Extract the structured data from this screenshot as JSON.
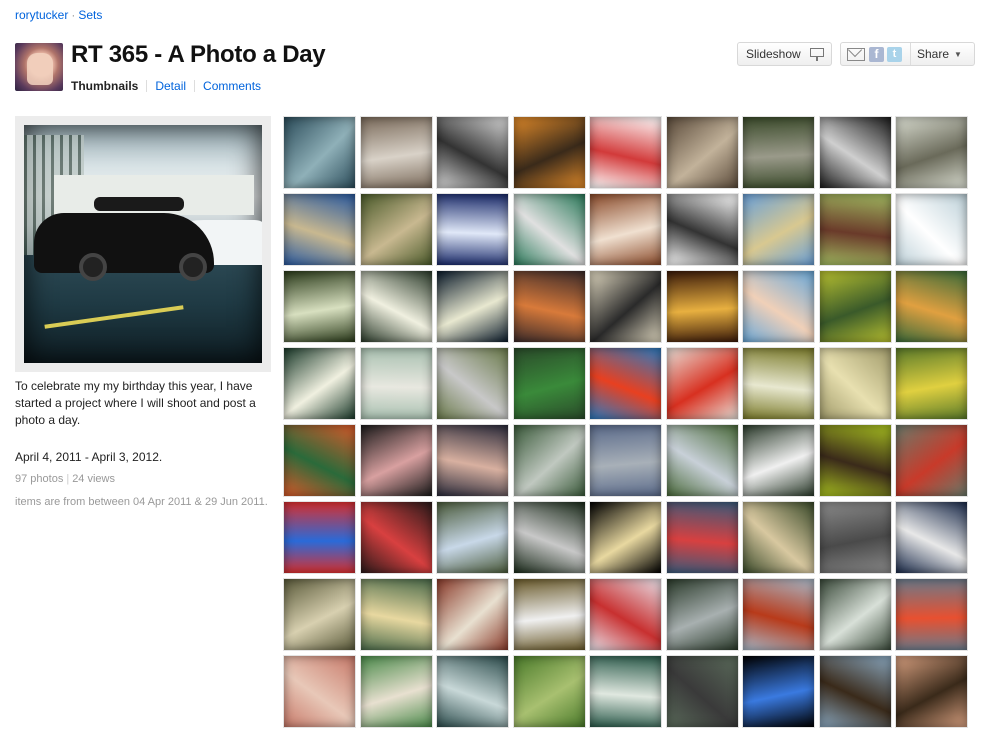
{
  "breadcrumb": {
    "user": "rorytucker",
    "separator": "·",
    "section": "Sets"
  },
  "set": {
    "title": "RT 365 - A Photo a Day"
  },
  "tabs": {
    "thumbnails": "Thumbnails",
    "detail": "Detail",
    "comments": "Comments"
  },
  "toolbar": {
    "slideshow_label": "Slideshow",
    "share_label": "Share",
    "facebook": "f",
    "twitter": "t"
  },
  "description": {
    "text": "To celebrate my my birthday this year, I have started a project where I will shoot and post a photo a day.",
    "dates": "April 4, 2011 - April 3, 2012.",
    "photos": "97 photos",
    "views": "24 views",
    "range": "items are from between 04 Apr 2011 & 29 Jun 2011."
  },
  "colors": {
    "link": "#0063dc",
    "muted": "#999999"
  },
  "thumbnails": [
    {
      "c1": "#2b4c5a",
      "c2": "#8fb0b8"
    },
    {
      "c1": "#7a6a5a",
      "c2": "#d9d2c8"
    },
    {
      "c1": "#d8d8d8",
      "c2": "#333333"
    },
    {
      "c1": "#e08a2a",
      "c2": "#3a2a1a"
    },
    {
      "c1": "#ffffff",
      "c2": "#d23a3a"
    },
    {
      "c1": "#5a4a3a",
      "c2": "#c2b29a"
    },
    {
      "c1": "#3a4a2a",
      "c2": "#9a9a8a"
    },
    {
      "c1": "#1a1a1a",
      "c2": "#cfcfcf"
    },
    {
      "c1": "#d9dcd0",
      "c2": "#6a6a5a"
    },
    {
      "c1": "#2a5aa0",
      "c2": "#c8b890"
    },
    {
      "c1": "#4a5a2a",
      "c2": "#c8b890"
    },
    {
      "c1": "#1a2a6a",
      "c2": "#e0e8f8"
    },
    {
      "c1": "#2a7a5a",
      "c2": "#e0e0e0"
    },
    {
      "c1": "#8a4a2a",
      "c2": "#f0e0d0"
    },
    {
      "c1": "#ffffff",
      "c2": "#333333"
    },
    {
      "c1": "#6aa0d8",
      "c2": "#d8c890"
    },
    {
      "c1": "#a0b860",
      "c2": "#6a3a2a"
    },
    {
      "c1": "#bcd0d8",
      "c2": "#ffffff"
    },
    {
      "c1": "#2a3a1a",
      "c2": "#d8e0c0"
    },
    {
      "c1": "#2a3a2a",
      "c2": "#f0f0e0"
    },
    {
      "c1": "#0a1a2a",
      "c2": "#e8e8d0"
    },
    {
      "c1": "#3a2a2a",
      "c2": "#d87a3a"
    },
    {
      "c1": "#e0d8c0",
      "c2": "#2a2a2a"
    },
    {
      "c1": "#3a1a0a",
      "c2": "#e8b040"
    },
    {
      "c1": "#6aa8d8",
      "c2": "#f0d0b8"
    },
    {
      "c1": "#b8c030",
      "c2": "#3a5a2a"
    },
    {
      "c1": "#3a6a3a",
      "c2": "#e0a040"
    },
    {
      "c1": "#1a3a2a",
      "c2": "#f0f0e0"
    },
    {
      "c1": "#a8c0b0",
      "c2": "#e8e8e0"
    },
    {
      "c1": "#6a7a4a",
      "c2": "#c8c8c8"
    },
    {
      "c1": "#2a4a2a",
      "c2": "#3a8a3a"
    },
    {
      "c1": "#2a7ac0",
      "c2": "#e84020"
    },
    {
      "c1": "#e8e0d8",
      "c2": "#d83020"
    },
    {
      "c1": "#7a7a2a",
      "c2": "#e8e8d0"
    },
    {
      "c1": "#a09a6a",
      "c2": "#e8e0b0"
    },
    {
      "c1": "#5a7a2a",
      "c2": "#e0d040"
    },
    {
      "c1": "#d85a2a",
      "c2": "#2a6a3a"
    },
    {
      "c1": "#1a1a1a",
      "c2": "#d8a0a0"
    },
    {
      "c1": "#2a2a3a",
      "c2": "#d8b0a0"
    },
    {
      "c1": "#3a5a3a",
      "c2": "#c0c8c0"
    },
    {
      "c1": "#5a6a8a",
      "c2": "#a8b0b8"
    },
    {
      "c1": "#4a6a3a",
      "c2": "#c8d0d8"
    },
    {
      "c1": "#2a3a2a",
      "c2": "#f0f0f0"
    },
    {
      "c1": "#a8c020",
      "c2": "#3a2a1a"
    },
    {
      "c1": "#6a7a6a",
      "c2": "#c83a2a"
    },
    {
      "c1": "#d83030",
      "c2": "#2a6ad8"
    },
    {
      "c1": "#2a1a1a",
      "c2": "#d84040"
    },
    {
      "c1": "#4a5a3a",
      "c2": "#c8d8e8"
    },
    {
      "c1": "#1a2a1a",
      "c2": "#c8c8c8"
    },
    {
      "c1": "#000000",
      "c2": "#e8d8a0"
    },
    {
      "c1": "#3a5a7a",
      "c2": "#d84040"
    },
    {
      "c1": "#3a4a2a",
      "c2": "#d8c8a0"
    },
    {
      "c1": "#8a8a8a",
      "c2": "#4a4a4a"
    },
    {
      "c1": "#1a2a4a",
      "c2": "#e8e8e8"
    },
    {
      "c1": "#5a5a3a",
      "c2": "#d8d0b0"
    },
    {
      "c1": "#4a6a4a",
      "c2": "#e8d8a0"
    },
    {
      "c1": "#8a3a2a",
      "c2": "#e8e0d0"
    },
    {
      "c1": "#6a5a2a",
      "c2": "#f0f0f0"
    },
    {
      "c1": "#e8e0e8",
      "c2": "#c83030"
    },
    {
      "c1": "#2a3a2a",
      "c2": "#a8b0b0"
    },
    {
      "c1": "#a8b8c8",
      "c2": "#b83a1a"
    },
    {
      "c1": "#3a4a3a",
      "c2": "#d8e0d8"
    },
    {
      "c1": "#6a7a8a",
      "c2": "#e85030"
    },
    {
      "c1": "#c87a6a",
      "c2": "#e8c8b8"
    },
    {
      "c1": "#4a8a4a",
      "c2": "#e8e0d0"
    },
    {
      "c1": "#2a4a4a",
      "c2": "#c8d8d8"
    },
    {
      "c1": "#4a7a2a",
      "c2": "#a8c070"
    },
    {
      "c1": "#2a5a4a",
      "c2": "#e0e8e0"
    },
    {
      "c1": "#5a6a5a",
      "c2": "#3a3a3a"
    },
    {
      "c1": "#000000",
      "c2": "#3a7ae0"
    },
    {
      "c1": "#8aa8c0",
      "c2": "#3a2a1a"
    },
    {
      "c1": "#d8a080",
      "c2": "#3a2a1a"
    }
  ]
}
